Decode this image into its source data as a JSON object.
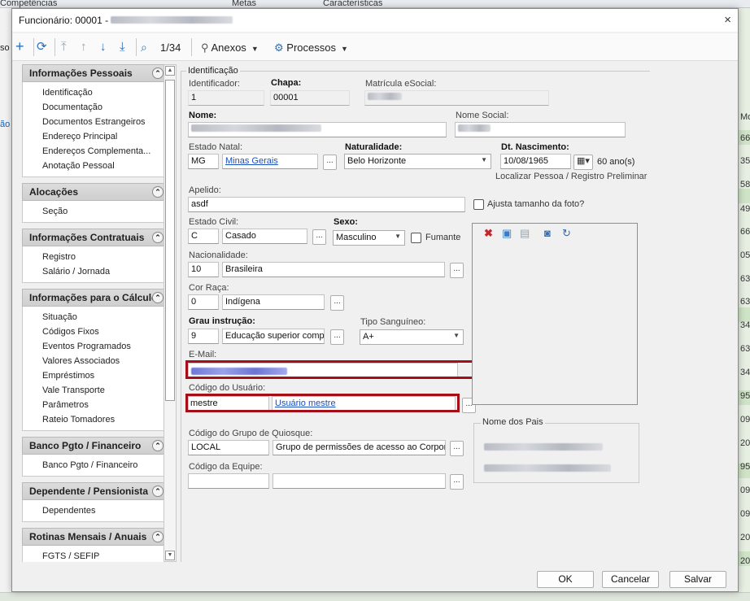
{
  "background": {
    "tabs": [
      "Competências",
      "Metas",
      "Características"
    ],
    "left_partial_labels": [
      "so",
      "ão"
    ],
    "right_partial_values": [
      "Mo",
      "66",
      "35",
      "58",
      "49",
      "66",
      "05",
      "63",
      "63",
      "34",
      "63",
      "34",
      "95",
      "09",
      "20",
      "95",
      "09",
      "09",
      "20",
      "20"
    ]
  },
  "dialog": {
    "title": "Funcionário: 00001 -",
    "close_icon": "×"
  },
  "toolbar": {
    "position": "1/34",
    "anexos": "Anexos",
    "processos": "Processos"
  },
  "sidebar": {
    "groups": [
      {
        "title": "Informações Pessoais",
        "items": [
          "Identificação",
          "Documentação",
          "Documentos Estrangeiros",
          "Endereço Principal",
          "Endereços Complementa...",
          "Anotação Pessoal"
        ]
      },
      {
        "title": "Alocações",
        "items": [
          "Seção"
        ]
      },
      {
        "title": "Informações Contratuais",
        "items": [
          "Registro",
          "Salário / Jornada"
        ]
      },
      {
        "title": "Informações para o Cálculo",
        "items": [
          "Situação",
          "Códigos Fixos",
          "Eventos Programados",
          "Valores Associados",
          "Empréstimos",
          "Vale Transporte",
          "Parâmetros",
          "Rateio Tomadores"
        ]
      },
      {
        "title": "Banco Pgto / Financeiro",
        "items": [
          "Banco Pgto / Financeiro"
        ]
      },
      {
        "title": "Dependente / Pensionista",
        "items": [
          "Dependentes"
        ]
      },
      {
        "title": "Rotinas Mensais / Anuais",
        "items": [
          "FGTS / SEFIP"
        ]
      }
    ]
  },
  "form": {
    "legend": "Identificação",
    "identificador": {
      "label": "Identificador:",
      "value": "1"
    },
    "chapa": {
      "label": "Chapa:",
      "value": "00001"
    },
    "matricula": {
      "label": "Matrícula eSocial:"
    },
    "nome": {
      "label": "Nome:"
    },
    "nome_social": {
      "label": "Nome Social:"
    },
    "estado_natal": {
      "label": "Estado Natal:",
      "code": "MG",
      "name": "Minas Gerais"
    },
    "naturalidade": {
      "label": "Naturalidade:",
      "value": "Belo Horizonte"
    },
    "dt_nascimento": {
      "label": "Dt. Nascimento:",
      "value": "10/08/1965",
      "age": "60 ano(s)"
    },
    "localizar": "Localizar Pessoa / Registro Preliminar",
    "apelido": {
      "label": "Apelido:",
      "value": "asdf"
    },
    "ajusta_foto": "Ajusta tamanho da foto?",
    "estado_civil": {
      "label": "Estado Civil:",
      "code": "C",
      "name": "Casado"
    },
    "sexo": {
      "label": "Sexo:",
      "value": "Masculino"
    },
    "fumante": "Fumante",
    "nacionalidade": {
      "label": "Nacionalidade:",
      "code": "10",
      "name": "Brasileira"
    },
    "cor_raca": {
      "label": "Cor Raça:",
      "code": "0",
      "name": "Indígena"
    },
    "grau_instrucao": {
      "label": "Grau instrução:",
      "code": "9",
      "name": "Educação superior compl"
    },
    "tipo_sanguineo": {
      "label": "Tipo Sanguíneo:",
      "value": "A+"
    },
    "email": {
      "label": "E-Mail:"
    },
    "codigo_usuario": {
      "label": "Código do Usuário:",
      "value": "mestre",
      "name": "Usuário mestre"
    },
    "grupo_quiosque": {
      "label": "Código do Grupo de Quiosque:",
      "code": "LOCAL",
      "name": "Grupo de permissões de acesso ao Corporel"
    },
    "codigo_equipe": {
      "label": "Código da Equipe:"
    },
    "nome_pais": "Nome dos Pais",
    "dots": "..."
  },
  "buttons": {
    "ok": "OK",
    "cancel": "Cancelar",
    "save": "Salvar"
  }
}
